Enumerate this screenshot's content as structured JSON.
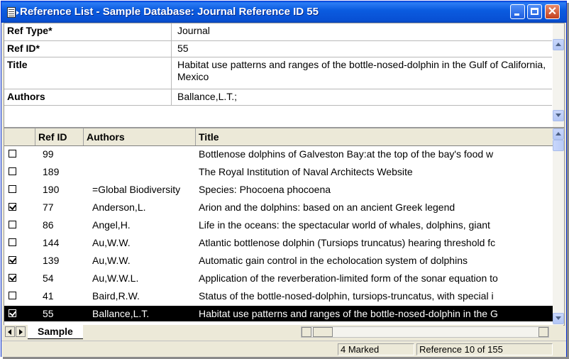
{
  "window": {
    "title": "Reference List - Sample Database: Journal Reference ID 55"
  },
  "detail": {
    "fields": [
      {
        "label": "Ref Type*",
        "value": "Journal"
      },
      {
        "label": "Ref ID*",
        "value": "55"
      },
      {
        "label": "Title",
        "value": "Habitat use patterns and ranges of the bottle-nosed-dolphin in the Gulf of California, Mexico"
      },
      {
        "label": "Authors",
        "value": "Ballance,L.T.;"
      }
    ]
  },
  "list": {
    "columns": {
      "ref_id": "Ref ID",
      "authors": "Authors",
      "title": "Title"
    },
    "rows": [
      {
        "checked": false,
        "ref_id": "99",
        "authors": "",
        "title": "Bottlenose dolphins of Galveston Bay:at the top of the bay's food w"
      },
      {
        "checked": false,
        "ref_id": "189",
        "authors": "",
        "title": "The Royal Institution of Naval Architects Website"
      },
      {
        "checked": false,
        "ref_id": "190",
        "authors": "=Global Biodiversity",
        "title": "Species: Phocoena phocoena"
      },
      {
        "checked": true,
        "ref_id": "77",
        "authors": "Anderson,L.",
        "title": "Arion and the dolphins: based on an ancient Greek legend"
      },
      {
        "checked": false,
        "ref_id": "86",
        "authors": "Angel,H.",
        "title": "Life in the oceans: the spectacular world of whales, dolphins, giant"
      },
      {
        "checked": false,
        "ref_id": "144",
        "authors": "Au,W.W.",
        "title": "Atlantic bottlenose dolphin (Tursiops truncatus) hearing threshold fc"
      },
      {
        "checked": true,
        "ref_id": "139",
        "authors": "Au,W.W.",
        "title": "Automatic gain control in the echolocation system of dolphins"
      },
      {
        "checked": true,
        "ref_id": "54",
        "authors": "Au,W.W.L.",
        "title": "Application of the reverberation-limited form of the sonar equation to"
      },
      {
        "checked": false,
        "ref_id": "41",
        "authors": "Baird,R.W.",
        "title": "Status of the bottle-nosed-dolphin, tursiops-truncatus, with special i"
      },
      {
        "checked": true,
        "ref_id": "55",
        "authors": "Ballance,L.T.",
        "title": "Habitat use patterns and ranges of the bottle-nosed-dolphin in the G",
        "selected": true
      }
    ]
  },
  "tabs": {
    "sheet": "Sample"
  },
  "status": {
    "marked": "4 Marked",
    "position": "Reference 10 of 155"
  }
}
